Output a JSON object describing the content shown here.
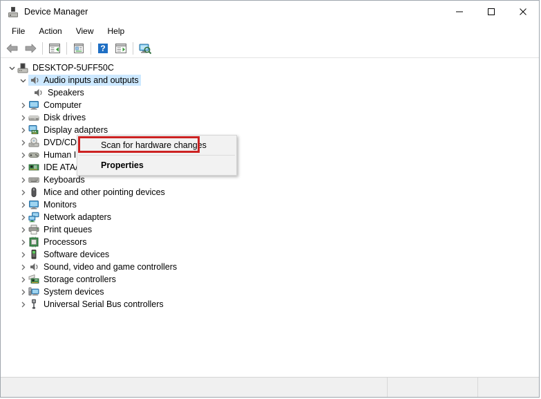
{
  "window": {
    "title": "Device Manager",
    "app_icon": "device-manager-icon",
    "controls": {
      "minimize": "minimize-icon",
      "maximize": "maximize-icon",
      "close": "close-icon"
    }
  },
  "menubar": {
    "items": [
      {
        "label": "File"
      },
      {
        "label": "Action"
      },
      {
        "label": "View"
      },
      {
        "label": "Help"
      }
    ]
  },
  "toolbar": {
    "buttons": [
      {
        "name": "back-arrow-icon"
      },
      {
        "name": "forward-arrow-icon"
      },
      {
        "name": "separator-1"
      },
      {
        "name": "show-hide-console-tree-icon"
      },
      {
        "name": "separator-2"
      },
      {
        "name": "properties-icon"
      },
      {
        "name": "separator-3"
      },
      {
        "name": "help-icon"
      },
      {
        "name": "update-driver-icon"
      },
      {
        "name": "separator-4"
      },
      {
        "name": "scan-for-hardware-changes-icon"
      }
    ]
  },
  "tree": {
    "root": {
      "label": "DESKTOP-5UFF50C",
      "icon": "computer-device-icon",
      "expanded": true,
      "level": 0,
      "selected": false
    },
    "items": [
      {
        "label": "Audio inputs and outputs",
        "icon": "speaker-icon",
        "expanded": true,
        "level": 1,
        "selected": true
      },
      {
        "label": "Speakers",
        "icon": "speaker-icon",
        "expanded": null,
        "level": 2,
        "selected": false
      },
      {
        "label": "Computer",
        "icon": "monitor-icon",
        "expanded": false,
        "level": 1,
        "selected": false
      },
      {
        "label": "Disk drives",
        "icon": "disk-drive-icon",
        "expanded": false,
        "level": 1,
        "selected": false
      },
      {
        "label": "Display adapters",
        "icon": "display-adapter-icon",
        "expanded": false,
        "level": 1,
        "selected": false
      },
      {
        "label": "DVD/CD-ROM drives",
        "icon": "dvd-drive-icon",
        "expanded": false,
        "level": 1,
        "selected": false
      },
      {
        "label": "Human Interface Devices",
        "icon": "hid-icon",
        "expanded": false,
        "level": 1,
        "selected": false
      },
      {
        "label": "IDE ATA/ATAPI controllers",
        "icon": "ide-controller-icon",
        "expanded": false,
        "level": 1,
        "selected": false
      },
      {
        "label": "Keyboards",
        "icon": "keyboard-icon",
        "expanded": false,
        "level": 1,
        "selected": false
      },
      {
        "label": "Mice and other pointing devices",
        "icon": "mouse-icon",
        "expanded": false,
        "level": 1,
        "selected": false
      },
      {
        "label": "Monitors",
        "icon": "monitor-icon",
        "expanded": false,
        "level": 1,
        "selected": false
      },
      {
        "label": "Network adapters",
        "icon": "network-adapter-icon",
        "expanded": false,
        "level": 1,
        "selected": false
      },
      {
        "label": "Print queues",
        "icon": "printer-icon",
        "expanded": false,
        "level": 1,
        "selected": false
      },
      {
        "label": "Processors",
        "icon": "processor-icon",
        "expanded": false,
        "level": 1,
        "selected": false
      },
      {
        "label": "Software devices",
        "icon": "software-device-icon",
        "expanded": false,
        "level": 1,
        "selected": false
      },
      {
        "label": "Sound, video and game controllers",
        "icon": "speaker-icon",
        "expanded": false,
        "level": 1,
        "selected": false
      },
      {
        "label": "Storage controllers",
        "icon": "storage-controller-icon",
        "expanded": false,
        "level": 1,
        "selected": false
      },
      {
        "label": "System devices",
        "icon": "system-device-icon",
        "expanded": false,
        "level": 1,
        "selected": false
      },
      {
        "label": "Universal Serial Bus controllers",
        "icon": "usb-icon",
        "expanded": false,
        "level": 1,
        "selected": false
      }
    ]
  },
  "context_menu": {
    "visible": true,
    "items": [
      {
        "label": "Scan for hardware changes",
        "bold": false,
        "highlighted": true
      },
      {
        "label": "Properties",
        "bold": true,
        "highlighted": false
      }
    ]
  },
  "annotation": {
    "highlight_color": "#cc2222",
    "target": "Scan for hardware changes"
  },
  "statusbar": {
    "pane1": "",
    "pane2": "",
    "pane3": ""
  },
  "colors": {
    "selection": "#cce8ff",
    "accent_red": "#cc2222",
    "window_bg": "#ffffff",
    "statusbar_bg": "#f0f0f0",
    "menu_bg": "#f2f2f2"
  }
}
